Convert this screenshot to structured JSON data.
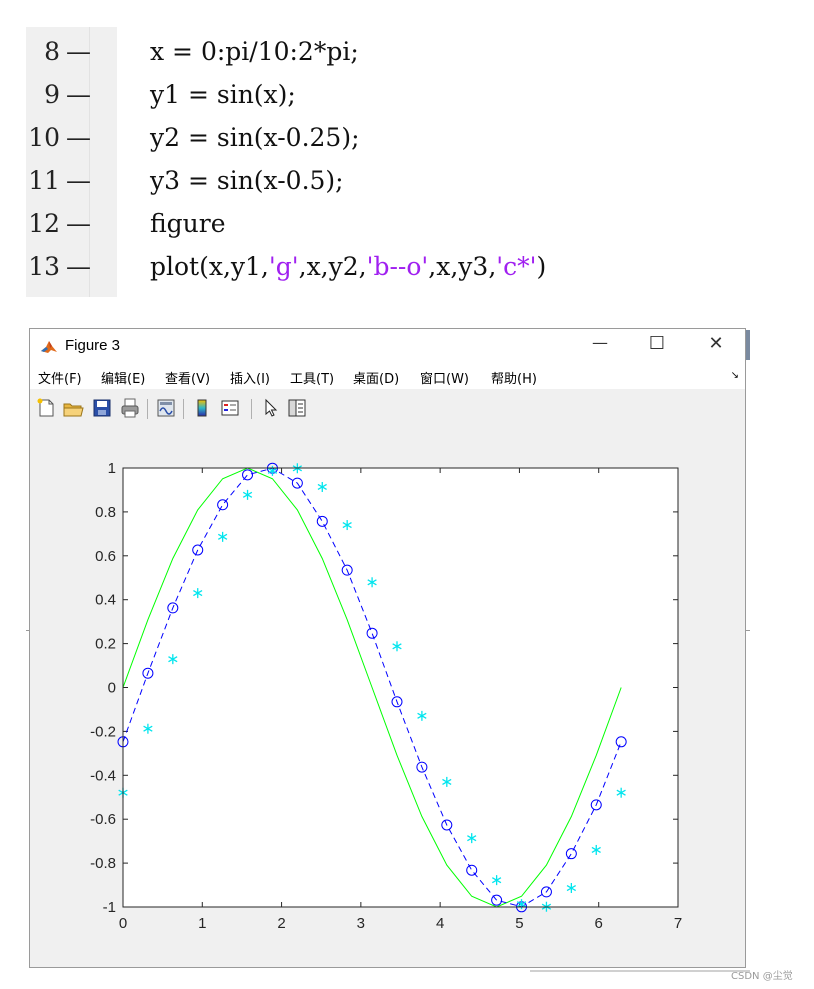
{
  "code": {
    "lines": [
      {
        "num": "8",
        "dash": "—",
        "parts": [
          {
            "t": "x = 0:pi/10:2*pi;",
            "s": false
          }
        ]
      },
      {
        "num": "9",
        "dash": "—",
        "parts": [
          {
            "t": "y1 = sin(x);",
            "s": false
          }
        ]
      },
      {
        "num": "10",
        "dash": "—",
        "parts": [
          {
            "t": "y2 = sin(x-0.25);",
            "s": false
          }
        ]
      },
      {
        "num": "11",
        "dash": "—",
        "parts": [
          {
            "t": "y3 = sin(x-0.5);",
            "s": false
          }
        ]
      },
      {
        "num": "12",
        "dash": "—",
        "parts": [
          {
            "t": "figure",
            "s": false
          }
        ]
      },
      {
        "num": "13",
        "dash": "—",
        "parts": [
          {
            "t": "plot(x,y1,",
            "s": false
          },
          {
            "t": "'g'",
            "s": true
          },
          {
            "t": ",x,y2,",
            "s": false
          },
          {
            "t": "'b--o'",
            "s": true
          },
          {
            "t": ",x,y3,",
            "s": false
          },
          {
            "t": "'c*'",
            "s": true
          },
          {
            "t": ")",
            "s": false
          }
        ]
      }
    ],
    "string_color": "#a020f0"
  },
  "window": {
    "title": "Figure 3",
    "icon": "matlab-logo-icon",
    "controls": {
      "minimize": "—",
      "maximize": "☐",
      "close": "✕"
    }
  },
  "menu": {
    "items": [
      "文件(F)",
      "编辑(E)",
      "查看(V)",
      "插入(I)",
      "工具(T)",
      "桌面(D)",
      "窗口(W)",
      "帮助(H)"
    ],
    "overflow_icon": "dock-arrow-icon"
  },
  "toolbar": {
    "icons": [
      "new-figure-icon",
      "open-file-icon",
      "save-icon",
      "print-icon",
      "link-plot-icon",
      "colorbar-icon",
      "legend-icon",
      "pointer-icon",
      "property-editor-icon"
    ]
  },
  "chart_data": {
    "type": "line",
    "title": "",
    "xlabel": "",
    "ylabel": "",
    "xlim": [
      0,
      7
    ],
    "ylim": [
      -1,
      1
    ],
    "xticks": [
      "0",
      "1",
      "2",
      "3",
      "4",
      "5",
      "6",
      "7"
    ],
    "yticks": [
      "1",
      "0.8",
      "0.6",
      "0.4",
      "0.2",
      "0",
      "-0.2",
      "-0.4",
      "-0.6",
      "-0.8",
      "-1"
    ],
    "x": [
      0,
      0.3142,
      0.6283,
      0.9425,
      1.2566,
      1.5708,
      1.885,
      2.1991,
      2.5133,
      2.8274,
      3.1416,
      3.4558,
      3.7699,
      4.0841,
      4.3982,
      4.7124,
      5.0265,
      5.3407,
      5.6549,
      5.969,
      6.2832
    ],
    "series": [
      {
        "style": "green solid line",
        "color": "#00ff00",
        "marker": "none",
        "values": [
          0,
          0.309,
          0.5878,
          0.809,
          0.9511,
          1,
          0.9511,
          0.809,
          0.5878,
          0.309,
          0,
          -0.309,
          -0.5878,
          -0.809,
          -0.9511,
          -1,
          -0.9511,
          -0.809,
          -0.5878,
          -0.309,
          0
        ]
      },
      {
        "style": "blue dashed line with circle markers",
        "color": "#0000ff",
        "marker": "circle",
        "values": [
          -0.2474,
          0.0652,
          0.3626,
          0.6264,
          0.8324,
          0.9689,
          0.9991,
          0.9312,
          0.7571,
          0.5346,
          0.2474,
          -0.0652,
          -0.3626,
          -0.6264,
          -0.8324,
          -0.9689,
          -0.9991,
          -0.9312,
          -0.7571,
          -0.5346,
          -0.2474
        ]
      },
      {
        "style": "cyan asterisk markers",
        "color": "#00e5ee",
        "marker": "asterisk",
        "values": [
          -0.4794,
          -0.1878,
          0.1292,
          0.43,
          0.6863,
          0.8776,
          0.987,
          0.9988,
          0.9135,
          0.7401,
          0.4794,
          0.1878,
          -0.1292,
          -0.43,
          -0.6863,
          -0.8776,
          -0.987,
          -0.9988,
          -0.9135,
          -0.7401,
          -0.4794
        ]
      }
    ],
    "grid": false,
    "box": true
  },
  "watermark": "CSDN @尘觉"
}
